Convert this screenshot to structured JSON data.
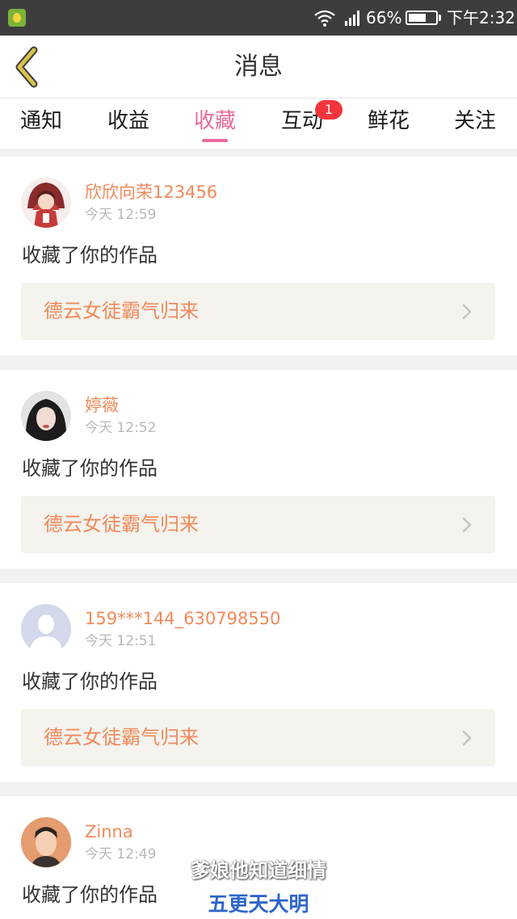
{
  "status_bar": {
    "battery_percent": "66%",
    "battery_level": 0.66,
    "time": "下午2:32",
    "icons": [
      "app-icon",
      "wifi-icon",
      "signal-icon",
      "battery-icon"
    ]
  },
  "header": {
    "title": "消息",
    "back_icon": "chevron-left-icon",
    "accent_color": "#d6c24a"
  },
  "tabs": [
    {
      "label": "通知",
      "active": false
    },
    {
      "label": "收益",
      "active": false
    },
    {
      "label": "收藏",
      "active": true
    },
    {
      "label": "互动",
      "active": false,
      "badge": "1"
    },
    {
      "label": "鲜花",
      "active": false
    },
    {
      "label": "关注",
      "active": false
    }
  ],
  "colors": {
    "active_tab": "#e96a9a",
    "username": "#f08a5a",
    "badge": "#f2353d",
    "work_box_bg": "#f4f3ee"
  },
  "messages": [
    {
      "username": "欣欣向荣123456",
      "time": "今天 12:59",
      "action": "收藏了你的作品",
      "work_title": "德云女徒霸气归来",
      "avatar": "anime-girl-avatar"
    },
    {
      "username": "婷薇",
      "time": "今天 12:52",
      "action": "收藏了你的作品",
      "work_title": "德云女徒霸气归来",
      "avatar": "photo-avatar"
    },
    {
      "username": "159***144_630798550",
      "time": "今天 12:51",
      "action": "收藏了你的作品",
      "work_title": "德云女徒霸气归来",
      "avatar": "default-user-avatar"
    },
    {
      "username": "Zinna",
      "time": "今天 12:49",
      "action": "收藏了你的作品",
      "avatar": "photo-avatar"
    }
  ],
  "subtitles": {
    "line1": "爹娘他知道细情",
    "line2": "五更天大明"
  }
}
